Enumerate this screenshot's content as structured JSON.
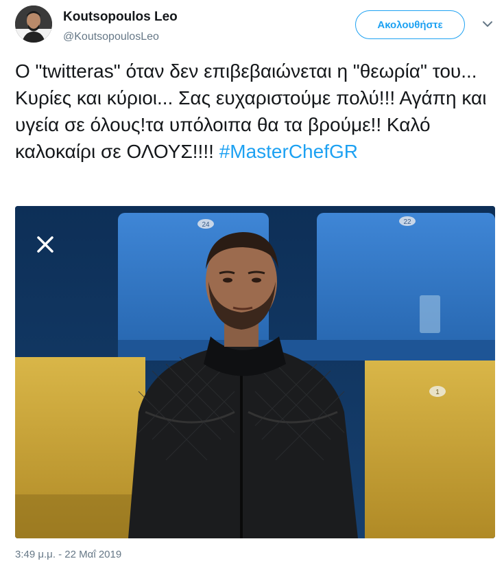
{
  "author": {
    "name": "Koutsopoulos Leo",
    "handle": "@KoutsopoulosLeo",
    "avatar_icon": "profile-photo"
  },
  "follow_button": {
    "label": "Ακολουθήστε",
    "color": "#1da1f2"
  },
  "menu": {
    "icon": "chevron-down-icon"
  },
  "tweet": {
    "text": "Ο \"twitteras\" όταν δεν επιβεβαιώνεται η \"θεωρία\" του... Κυρίες και κύριοι... Σας ευχαριστούμε πολύ!!! Αγάπη και υγεία σε όλους!τα υπόλοιπα θα τα βρούμε!! Καλό καλοκαίρι σε ΟΛΟΥΣ!!!! ",
    "hashtag": "#MasterChefGR",
    "hashtag_color": "#1da1f2"
  },
  "media": {
    "photo_icon": "photo-man-leather-jacket-studio-seats",
    "close_icon": "close-icon",
    "seat_numbers": [
      "24",
      "22",
      "1"
    ]
  },
  "timestamp": "3:49 μ.μ. - 22 Μαΐ 2019"
}
